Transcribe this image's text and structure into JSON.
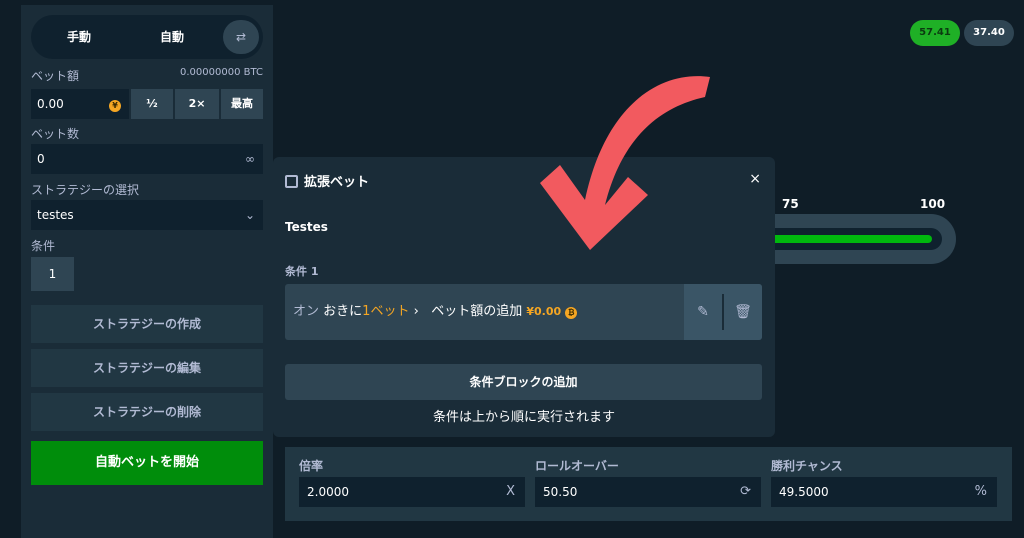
{
  "mode": {
    "manual": "手動",
    "auto": "自動",
    "icon": "arrows-swap-icon"
  },
  "bet_amount": {
    "label": "ベット額",
    "balance": "0.00000000 BTC",
    "value": "0.00",
    "currency_symbol": "¥",
    "half": "½",
    "double": "2×",
    "max": "最高"
  },
  "bet_count": {
    "label": "ベット数",
    "value": "0",
    "suffix": "∞"
  },
  "strategy": {
    "label": "ストラテジーの選択",
    "value": "testes"
  },
  "condition": {
    "label": "条件",
    "value": "1"
  },
  "strategy_buttons": {
    "create": "ストラテジーの作成",
    "edit": "ストラテジーの編集",
    "delete": "ストラテジーの削除"
  },
  "start_button": "自動ベットを開始",
  "history": {
    "recent_win": "57.41",
    "recent_other": "37.40"
  },
  "slider": {
    "mark_75": "75",
    "mark_100": "100"
  },
  "bottom": {
    "multiplier_label": "倍率",
    "multiplier_value": "2.0000",
    "multiplier_suffix": "X",
    "rollover_label": "ロールオーバー",
    "rollover_value": "50.50",
    "rollover_suffix": "⟳",
    "win_chance_label": "勝利チャンス",
    "win_chance_value": "49.5000",
    "win_chance_suffix": "%"
  },
  "modal": {
    "title": "拡張ベット",
    "close": "×",
    "strategy_name": "Testes",
    "condition_label": "条件 1",
    "condition": {
      "on": "オン",
      "every": "おきに",
      "count": "1ベット",
      "chevron": "›",
      "action": "ベット額の追加",
      "amount": "¥0.00"
    },
    "add_block": "条件ブロックの追加",
    "footer": "条件は上から順に実行されます"
  },
  "colors": {
    "accent_green": "#00b80e",
    "annotation_arrow": "#f25a5f",
    "amount_orange": "#f5a623"
  }
}
